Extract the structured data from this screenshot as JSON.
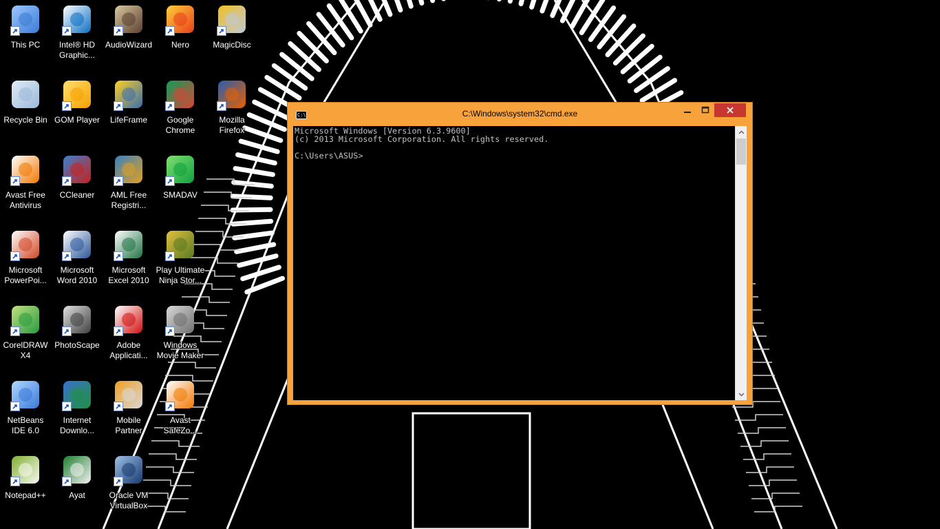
{
  "desktop": {
    "icons": [
      {
        "label": "This PC",
        "icon": "this-pc-icon"
      },
      {
        "label": "Intel® HD Graphic...",
        "icon": "intel-graphics-icon"
      },
      {
        "label": "AudioWizard",
        "icon": "audiowizard-icon"
      },
      {
        "label": "Nero",
        "icon": "nero-icon"
      },
      {
        "label": "MagicDisc",
        "icon": "magicdisc-icon"
      },
      {
        "label": "Recycle Bin",
        "icon": "recycle-bin-icon"
      },
      {
        "label": "GOM Player",
        "icon": "gom-player-icon"
      },
      {
        "label": "LifeFrame",
        "icon": "lifeframe-icon"
      },
      {
        "label": "Google Chrome",
        "icon": "chrome-icon"
      },
      {
        "label": "Mozilla Firefox",
        "icon": "firefox-icon"
      },
      {
        "label": "Avast Free Antivirus",
        "icon": "avast-icon"
      },
      {
        "label": "CCleaner",
        "icon": "ccleaner-icon"
      },
      {
        "label": "AML Free Registri...",
        "icon": "aml-registry-icon"
      },
      {
        "label": "SMADAV",
        "icon": "smadav-icon"
      },
      {
        "label": "Microsoft PowerPoi...",
        "icon": "powerpoint-icon"
      },
      {
        "label": "Microsoft Word 2010",
        "icon": "word-icon"
      },
      {
        "label": "Microsoft Excel 2010",
        "icon": "excel-icon"
      },
      {
        "label": "Play Ultimate Ninja Stor...",
        "icon": "naruto-game-icon"
      },
      {
        "label": "CorelDRAW X4",
        "icon": "coreldraw-icon"
      },
      {
        "label": "PhotoScape",
        "icon": "photoscape-icon"
      },
      {
        "label": "Adobe Applicati...",
        "icon": "adobe-icon"
      },
      {
        "label": "Windows Movie Maker",
        "icon": "movie-maker-icon"
      },
      {
        "label": "NetBeans IDE 6.0",
        "icon": "netbeans-icon"
      },
      {
        "label": "Internet Downlo...",
        "icon": "idm-icon"
      },
      {
        "label": "Mobile Partner",
        "icon": "mobile-partner-icon"
      },
      {
        "label": "Avast SafeZo...",
        "icon": "avast-safezone-icon"
      },
      {
        "label": "Notepad++",
        "icon": "notepadpp-icon"
      },
      {
        "label": "Ayat",
        "icon": "ayat-icon"
      },
      {
        "label": "Oracle VM VirtualBox",
        "icon": "virtualbox-icon"
      }
    ]
  },
  "cmd": {
    "title": "C:\\Windows\\system32\\cmd.exe",
    "icon_text": "C:\\",
    "lines": [
      "Microsoft Windows [Version 6.3.9600]",
      "(c) 2013 Microsoft Corporation. All rights reserved.",
      "",
      "C:\\Users\\ASUS>"
    ]
  },
  "colors": {
    "window_frame": "#f7a23a",
    "close_button": "#c7372f",
    "console_background": "#000000",
    "console_text": "#c0c0c0"
  }
}
